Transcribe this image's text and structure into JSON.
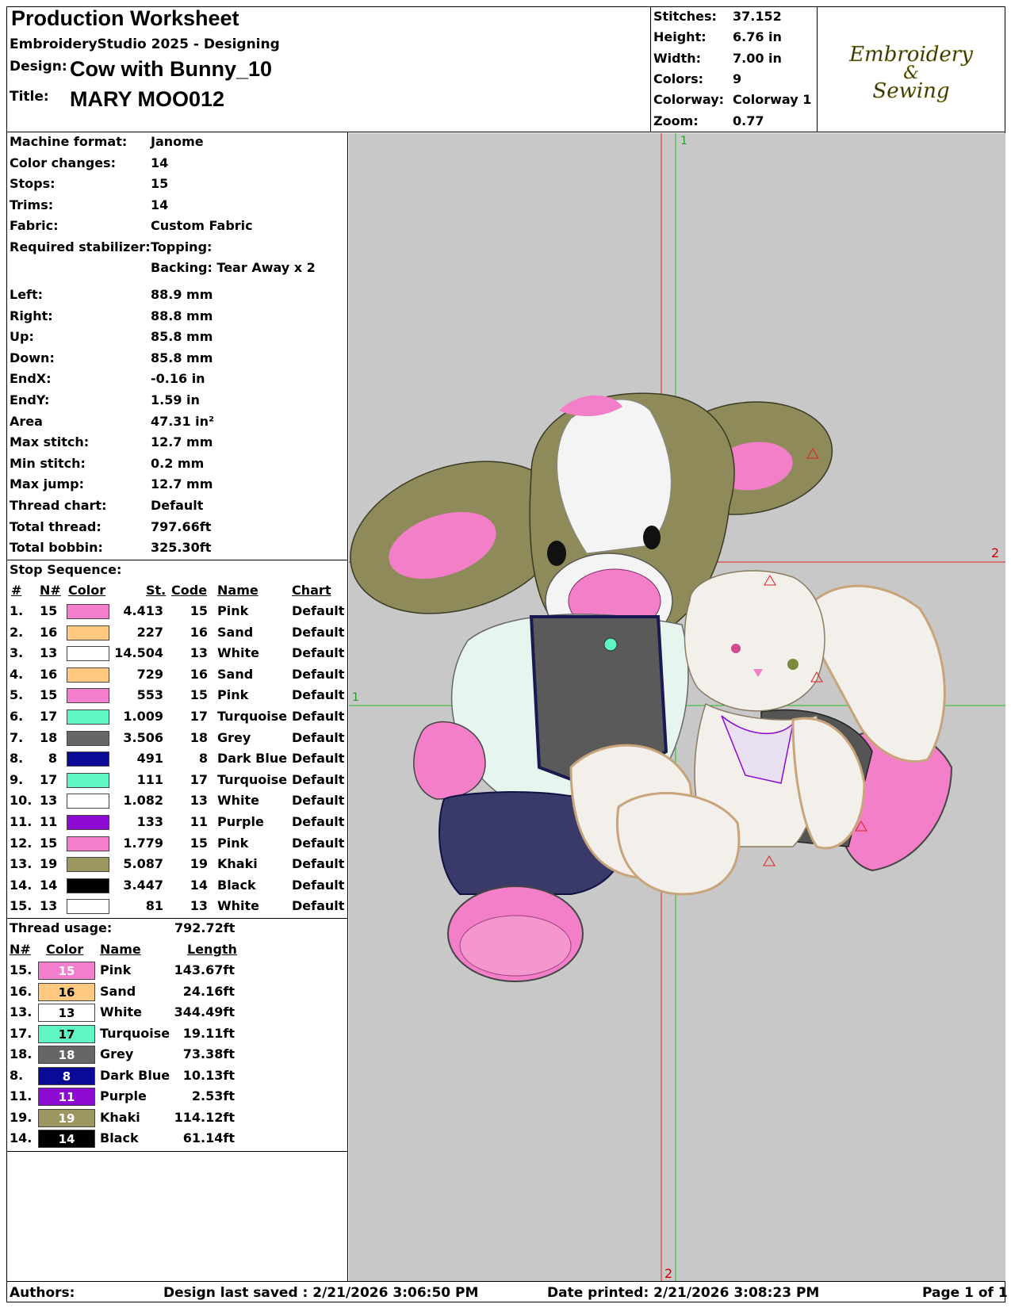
{
  "header": {
    "title": "Production Worksheet",
    "software": "EmbroideryStudio 2025 - Designing",
    "design_label": "Design:",
    "design_value": "Cow with Bunny_10",
    "title_label": "Title:",
    "title_value": "MARY MOO012"
  },
  "summary": [
    {
      "label": "Stitches:",
      "value": "37.152"
    },
    {
      "label": "Height:",
      "value": "6.76 in"
    },
    {
      "label": "Width:",
      "value": "7.00 in"
    },
    {
      "label": "Colors:",
      "value": "9"
    },
    {
      "label": "Colorway:",
      "value": "Colorway 1"
    },
    {
      "label": "Zoom:",
      "value": "0.77"
    }
  ],
  "logo": {
    "line1": "Embroidery",
    "line2": "&",
    "line3": "Sewing"
  },
  "machine_info": [
    {
      "label": "Machine format:",
      "value": "Janome"
    },
    {
      "label": "Color changes:",
      "value": "14"
    },
    {
      "label": "Stops:",
      "value": "15"
    },
    {
      "label": "Trims:",
      "value": "14"
    },
    {
      "label": "Fabric:",
      "value": "Custom Fabric"
    },
    {
      "label": "Required stabilizer:",
      "value": "Topping:"
    },
    {
      "label": "",
      "value": "Backing: Tear Away x 2"
    }
  ],
  "dimensions": [
    {
      "label": "Left:",
      "value": "88.9 mm"
    },
    {
      "label": "Right:",
      "value": "88.8 mm"
    },
    {
      "label": "Up:",
      "value": "85.8 mm"
    },
    {
      "label": "Down:",
      "value": "85.8 mm"
    },
    {
      "label": "EndX:",
      "value": "-0.16 in"
    },
    {
      "label": "EndY:",
      "value": "1.59 in"
    },
    {
      "label": "Area",
      "value": "47.31 in²"
    },
    {
      "label": "Max stitch:",
      "value": "12.7 mm"
    },
    {
      "label": "Min stitch:",
      "value": "0.2 mm"
    },
    {
      "label": "Max jump:",
      "value": "12.7 mm"
    },
    {
      "label": "Thread chart:",
      "value": "Default"
    },
    {
      "label": "Total thread:",
      "value": "797.66ft"
    },
    {
      "label": "Total bobbin:",
      "value": "325.30ft"
    }
  ],
  "stop_sequence": {
    "title": "Stop Sequence:",
    "headers": {
      "num": "#",
      "n": "N#",
      "color": "Color",
      "st": "St.",
      "code": "Code",
      "name": "Name",
      "chart": "Chart"
    },
    "rows": [
      {
        "num": "1.",
        "n": "15",
        "color": "#f57fcf",
        "st": "4.413",
        "code": "15",
        "name": "Pink",
        "chart": "Default"
      },
      {
        "num": "2.",
        "n": "16",
        "color": "#ffc981",
        "st": "227",
        "code": "16",
        "name": "Sand",
        "chart": "Default"
      },
      {
        "num": "3.",
        "n": "13",
        "color": "#ffffff",
        "st": "14.504",
        "code": "13",
        "name": "White",
        "chart": "Default"
      },
      {
        "num": "4.",
        "n": "16",
        "color": "#ffc981",
        "st": "729",
        "code": "16",
        "name": "Sand",
        "chart": "Default"
      },
      {
        "num": "5.",
        "n": "15",
        "color": "#f57fcf",
        "st": "553",
        "code": "15",
        "name": "Pink",
        "chart": "Default"
      },
      {
        "num": "6.",
        "n": "17",
        "color": "#5ff5c5",
        "st": "1.009",
        "code": "17",
        "name": "Turquoise",
        "chart": "Default"
      },
      {
        "num": "7.",
        "n": "18",
        "color": "#666666",
        "st": "3.506",
        "code": "18",
        "name": "Grey",
        "chart": "Default"
      },
      {
        "num": "8.",
        "n": "8",
        "color": "#0a0a96",
        "st": "491",
        "code": "8",
        "name": "Dark Blue",
        "chart": "Default"
      },
      {
        "num": "9.",
        "n": "17",
        "color": "#5ff5c5",
        "st": "111",
        "code": "17",
        "name": "Turquoise",
        "chart": "Default"
      },
      {
        "num": "10.",
        "n": "13",
        "color": "#ffffff",
        "st": "1.082",
        "code": "13",
        "name": "White",
        "chart": "Default"
      },
      {
        "num": "11.",
        "n": "11",
        "color": "#8c0ad2",
        "st": "133",
        "code": "11",
        "name": "Purple",
        "chart": "Default"
      },
      {
        "num": "12.",
        "n": "15",
        "color": "#f57fcf",
        "st": "1.779",
        "code": "15",
        "name": "Pink",
        "chart": "Default"
      },
      {
        "num": "13.",
        "n": "19",
        "color": "#9c9660",
        "st": "5.087",
        "code": "19",
        "name": "Khaki",
        "chart": "Default"
      },
      {
        "num": "14.",
        "n": "14",
        "color": "#000000",
        "st": "3.447",
        "code": "14",
        "name": "Black",
        "chart": "Default"
      },
      {
        "num": "15.",
        "n": "13",
        "color": "#ffffff",
        "st": "81",
        "code": "13",
        "name": "White",
        "chart": "Default"
      }
    ]
  },
  "thread_usage": {
    "title": "Thread usage:",
    "total": "792.72ft",
    "headers": {
      "n": "N#",
      "color": "Color",
      "name": "Name",
      "length": "Length"
    },
    "rows": [
      {
        "n": "15.",
        "code": "15",
        "color": "#f57fcf",
        "name": "Pink",
        "length": "143.67ft"
      },
      {
        "n": "16.",
        "code": "16",
        "color": "#ffc981",
        "name": "Sand",
        "length": "24.16ft"
      },
      {
        "n": "13.",
        "code": "13",
        "color": "#ffffff",
        "name": "White",
        "length": "344.49ft"
      },
      {
        "n": "17.",
        "code": "17",
        "color": "#5ff5c5",
        "name": "Turquoise",
        "length": "19.11ft"
      },
      {
        "n": "18.",
        "code": "18",
        "color": "#666666",
        "name": "Grey",
        "length": "73.38ft"
      },
      {
        "n": "8.",
        "code": "8",
        "color": "#0a0a96",
        "name": "Dark Blue",
        "length": "10.13ft"
      },
      {
        "n": "11.",
        "code": "11",
        "color": "#8c0ad2",
        "name": "Purple",
        "length": "2.53ft"
      },
      {
        "n": "19.",
        "code": "19",
        "color": "#9c9660",
        "name": "Khaki",
        "length": "114.12ft"
      },
      {
        "n": "14.",
        "code": "14",
        "color": "#000000",
        "name": "Black",
        "length": "61.14ft"
      }
    ]
  },
  "canvas": {
    "marker_top": "1",
    "marker_right": "2",
    "marker_left": "1",
    "marker_bottom": "2"
  },
  "footer": {
    "authors": "Authors:",
    "saved": "Design last saved : 2/21/2026 3:06:50 PM",
    "printed": "Date printed: 2/21/2026 3:08:23 PM",
    "page": "Page 1 of 1"
  }
}
